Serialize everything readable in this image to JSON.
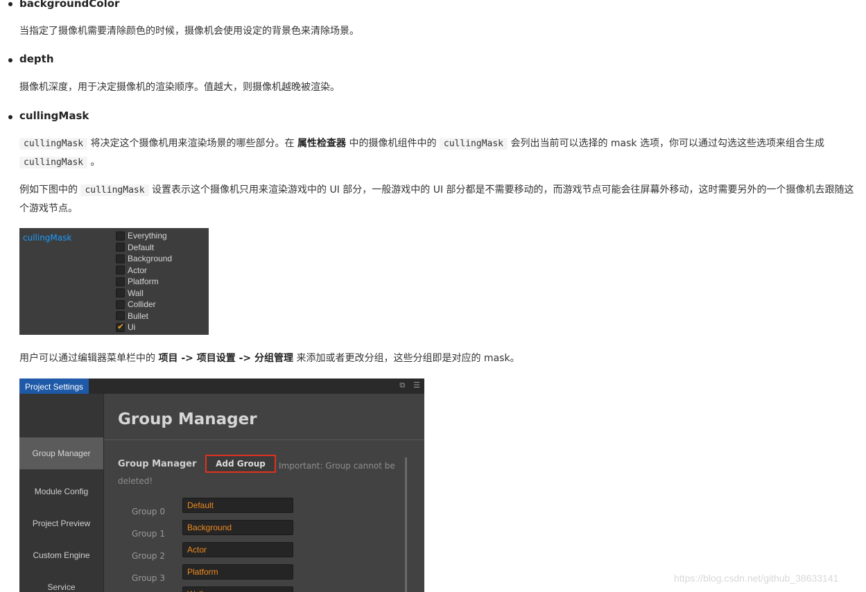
{
  "sections": {
    "background_color": {
      "title": "backgroundColor",
      "desc": "当指定了摄像机需要清除颜色的时候，摄像机会使用设定的背景色来清除场景。"
    },
    "depth": {
      "title": "depth",
      "desc": "摄像机深度，用于决定摄像机的渲染顺序。值越大，则摄像机越晚被渲染。"
    },
    "culling_mask": {
      "title": "cullingMask",
      "p1": {
        "code1": "cullingMask",
        "t1": " 将决定这个摄像机用来渲染场景的哪些部分。在 ",
        "bold": "属性检查器",
        "t2": " 中的摄像机组件中的 ",
        "code2": "cullingMask",
        "t3": " 会列出当前可以选择的 mask 选项，你可以通过勾选这些选项来组合生成 ",
        "code3": "cullingMask",
        "t4": " 。"
      },
      "p2": {
        "t1": "例如下图中的 ",
        "code": "cullingMask",
        "t2": " 设置表示这个摄像机只用来渲染游戏中的 UI 部分，一般游戏中的 UI 部分都是不需要移动的，而游戏节点可能会往屏幕外移动，这时需要另外的一个摄像机去跟随这个游戏节点。"
      },
      "p3": {
        "t1": "用户可以通过编辑器菜单栏中的 ",
        "bold": "项目 -> 项目设置 -> 分组管理",
        "t2": " 来添加或者更改分组，这些分组即是对应的 mask。"
      }
    }
  },
  "culling_panel": {
    "label": "cullingMask",
    "options": [
      {
        "label": "Everything",
        "checked": false
      },
      {
        "label": "Default",
        "checked": false
      },
      {
        "label": "Background",
        "checked": false
      },
      {
        "label": "Actor",
        "checked": false
      },
      {
        "label": "Platform",
        "checked": false
      },
      {
        "label": "Wall",
        "checked": false
      },
      {
        "label": "Collider",
        "checked": false
      },
      {
        "label": "Bullet",
        "checked": false
      },
      {
        "label": "Ui",
        "checked": true
      }
    ]
  },
  "project_settings": {
    "tab": "Project Settings",
    "sidebar": [
      "Group Manager",
      "Module Config",
      "Project Preview",
      "Custom Engine",
      "Service"
    ],
    "heading": "Group Manager",
    "sub_heading": "Group Manager",
    "add_button": "Add Group",
    "important": "Important: Group cannot be deleted!",
    "groups": [
      {
        "label": "Group 0",
        "value": "Default"
      },
      {
        "label": "Group 1",
        "value": "Background"
      },
      {
        "label": "Group 2",
        "value": "Actor"
      },
      {
        "label": "Group 3",
        "value": "Platform"
      },
      {
        "label": "",
        "value": "Wall"
      }
    ]
  },
  "watermark": "https://blog.csdn.net/github_38633141",
  "colors": {
    "panel_bg": "#3d3d3d",
    "accent_blue": "#1a9dff",
    "check_orange": "#f4a020",
    "group_value": "#f08b20",
    "tab_blue": "#1e5aa8",
    "highlight_red": "#e0301e"
  }
}
